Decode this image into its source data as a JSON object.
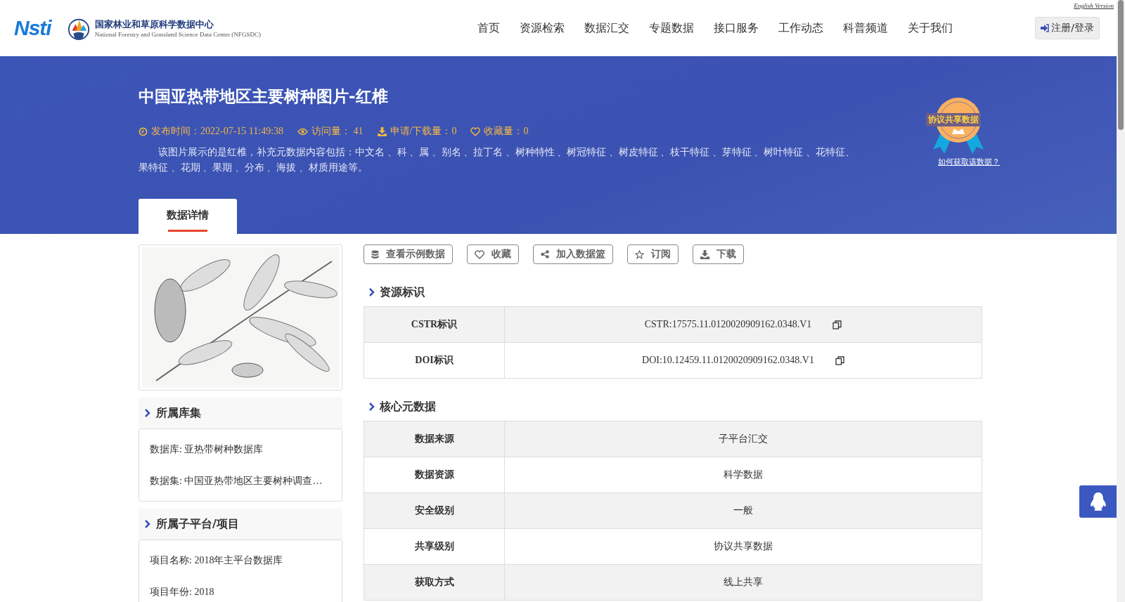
{
  "header": {
    "logo_text": "Nsti",
    "org_name": "国家林业和草原科学数据中心",
    "org_name_en": "National Forestry and Grassland Science Data Center (NFGSDC)",
    "english_link": "English Version",
    "login_button": "注册/登录",
    "nav": [
      "首页",
      "资源检索",
      "数据汇交",
      "专题数据",
      "接口服务",
      "工作动态",
      "科普频道",
      "关于我们"
    ]
  },
  "banner": {
    "title": "中国亚热带地区主要树种图片-红椎",
    "meta": [
      {
        "kind": "time",
        "text": "发布时间：2022-07-15 11:49:38"
      },
      {
        "kind": "views",
        "text": "访问量： 41"
      },
      {
        "kind": "downloads",
        "text": "申请/下载量：0"
      },
      {
        "kind": "favorites",
        "text": "收藏量：0"
      }
    ],
    "description": "该图片展示的是红椎，补充元数据内容包括：中文名 、科 、属 、别名 、拉丁名 、树种特性 、树冠特征 、树皮特征 、枝干特征 、芽特征 、树叶特征 、花特征、果特征 、花期 、果期 、分布 、海拔 、材质用途等。",
    "badge": {
      "text": "协议共享数据",
      "link": "如何获取该数据？"
    },
    "tabs": [
      {
        "label": "数据详情",
        "selected": true
      }
    ]
  },
  "sidebar": [
    {
      "title": "所属库集",
      "items": [
        "数据库: 亚热带树种数据库",
        "数据集: 中国亚热带地区主要树种调查…"
      ]
    },
    {
      "title": "所属子平台/项目",
      "items": [
        "项目名称: 2018年主平台数据库",
        "项目年份: 2018"
      ]
    }
  ],
  "actions": [
    {
      "kind": "database",
      "label": "查看示例数据"
    },
    {
      "kind": "heart",
      "label": "收藏"
    },
    {
      "kind": "share",
      "label": "加入数据篮"
    },
    {
      "kind": "star",
      "label": "订阅"
    },
    {
      "kind": "download",
      "label": "下载"
    }
  ],
  "sections": [
    {
      "title": "资源标识",
      "rows": [
        {
          "label": "CSTR标识",
          "value": "CSTR:17575.11.0120020909162.0348.V1",
          "copyable": true
        },
        {
          "label": "DOI标识",
          "value": "DOI:10.12459.11.0120020909162.0348.V1",
          "copyable": true
        }
      ]
    },
    {
      "title": "核心元数据",
      "rows": [
        {
          "label": "数据来源",
          "value": "子平台汇交",
          "copyable": false
        },
        {
          "label": "数据资源",
          "value": "科学数据",
          "copyable": false
        },
        {
          "label": "安全级别",
          "value": "一般",
          "copyable": false
        },
        {
          "label": "共享级别",
          "value": "协议共享数据",
          "copyable": false
        },
        {
          "label": "获取方式",
          "value": "线上共享",
          "copyable": false
        }
      ]
    }
  ]
}
